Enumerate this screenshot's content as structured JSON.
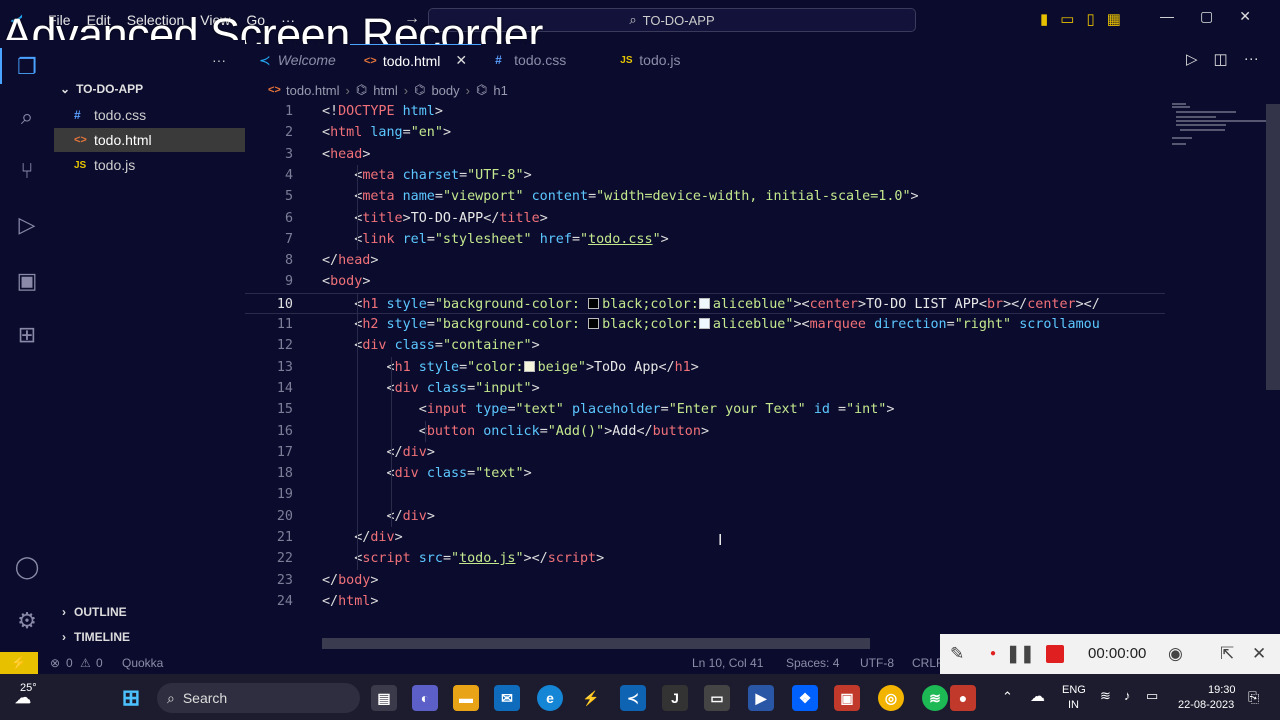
{
  "overlay_title": "Advanced Screen Recorder",
  "menu": [
    "File",
    "Edit",
    "Selection",
    "View",
    "Go",
    "···"
  ],
  "command_center": "TO-DO-APP",
  "sidebar": {
    "more": "···",
    "folder": "TO-DO-APP",
    "files": [
      {
        "name": "todo.css",
        "type": "css"
      },
      {
        "name": "todo.html",
        "type": "html",
        "selected": true
      },
      {
        "name": "todo.js",
        "type": "js"
      }
    ],
    "outline": "OUTLINE",
    "timeline": "TIMELINE"
  },
  "tabs": [
    {
      "label": "Welcome",
      "icon": "vscode"
    },
    {
      "label": "todo.html",
      "icon": "html",
      "active": true
    },
    {
      "label": "todo.css",
      "icon": "css"
    },
    {
      "label": "todo.js",
      "icon": "js"
    }
  ],
  "breadcrumb": [
    "todo.html",
    "html",
    "body",
    "h1"
  ],
  "code_lines": [
    {
      "n": "1",
      "html": "<span class='p'>&lt;!</span><span class='t'>DOCTYPE</span> <span class='a'>html</span><span class='p'>&gt;</span>"
    },
    {
      "n": "2",
      "html": "<span class='p'>&lt;</span><span class='t'>html</span> <span class='a'>lang</span><span class='p'>=</span><span class='s'>\"en\"</span><span class='p'>&gt;</span>"
    },
    {
      "n": "3",
      "html": "<span class='p'>&lt;</span><span class='t'>head</span><span class='p'>&gt;</span>"
    },
    {
      "n": "4",
      "html": "    <span class='p'>&lt;</span><span class='t'>meta</span> <span class='a'>charset</span><span class='p'>=</span><span class='s'>\"UTF-8\"</span><span class='p'>&gt;</span>"
    },
    {
      "n": "5",
      "html": "    <span class='p'>&lt;</span><span class='t'>meta</span> <span class='a'>name</span><span class='p'>=</span><span class='s'>\"viewport\"</span> <span class='a'>content</span><span class='p'>=</span><span class='s'>\"width=device-width, initial-scale=1.0\"</span><span class='p'>&gt;</span>"
    },
    {
      "n": "6",
      "html": "    <span class='p'>&lt;</span><span class='t'>title</span><span class='p'>&gt;</span><span class='c'>TO-DO-APP</span><span class='p'>&lt;/</span><span class='t'>title</span><span class='p'>&gt;</span>"
    },
    {
      "n": "7",
      "html": "    <span class='p'>&lt;</span><span class='t'>link</span> <span class='a'>rel</span><span class='p'>=</span><span class='s'>\"stylesheet\"</span> <span class='a'>href</span><span class='p'>=</span><span class='s'>\"<u>todo.css</u>\"</span><span class='p'>&gt;</span>"
    },
    {
      "n": "8",
      "html": "<span class='p'>&lt;/</span><span class='t'>head</span><span class='p'>&gt;</span>"
    },
    {
      "n": "9",
      "html": "<span class='p'>&lt;</span><span class='t'>body</span><span class='p'>&gt;</span>"
    },
    {
      "n": "10",
      "html": "    <span class='p'>&lt;</span><span class='t'>h1</span> <span class='a'>style</span><span class='p'>=</span><span class='s'>\"background-color: <span class='sw' style='background:#000'></span>black;color:<span class='sw' style='background:#f0f8ff'></span>aliceblue\"</span><span class='p'>&gt;&lt;</span><span class='t'>center</span><span class='p'>&gt;</span><span class='c'>TO-DO LIST APP</span><span class='p'>&lt;</span><span class='t'>br</span><span class='p'>&gt;&lt;/</span><span class='t'>center</span><span class='p'>&gt;&lt;/</span>",
      "current": true
    },
    {
      "n": "11",
      "html": "    <span class='p'>&lt;</span><span class='t'>h2</span> <span class='a'>style</span><span class='p'>=</span><span class='s'>\"background-color: <span class='sw' style='background:#000'></span>black;color:<span class='sw' style='background:#f0f8ff'></span>aliceblue\"</span><span class='p'>&gt;&lt;</span><span class='t'>marquee</span> <span class='a'>direction</span><span class='p'>=</span><span class='s'>\"right\"</span> <span class='a'>scrollamou</span>"
    },
    {
      "n": "12",
      "html": "    <span class='p'>&lt;</span><span class='t'>div</span> <span class='a'>class</span><span class='p'>=</span><span class='s'>\"container\"</span><span class='p'>&gt;</span>"
    },
    {
      "n": "13",
      "html": "        <span class='p'>&lt;</span><span class='t'>h1</span> <span class='a'>style</span><span class='p'>=</span><span class='s'>\"color:<span class='sw' style='background:#f5f5dc'></span>beige\"</span><span class='p'>&gt;</span><span class='c'>ToDo App</span><span class='p'>&lt;/</span><span class='t'>h1</span><span class='p'>&gt;</span>"
    },
    {
      "n": "14",
      "html": "        <span class='p'>&lt;</span><span class='t'>div</span> <span class='a'>class</span><span class='p'>=</span><span class='s'>\"input\"</span><span class='p'>&gt;</span>"
    },
    {
      "n": "15",
      "html": "            <span class='p'>&lt;</span><span class='t'>input</span> <span class='a'>type</span><span class='p'>=</span><span class='s'>\"text\"</span> <span class='a'>placeholder</span><span class='p'>=</span><span class='s'>\"Enter your Text\"</span> <span class='a'>id</span> <span class='p'>=</span><span class='s'>\"int\"</span><span class='p'>&gt;</span>"
    },
    {
      "n": "16",
      "html": "            <span class='p'>&lt;</span><span class='t'>button</span> <span class='a'>onclick</span><span class='p'>=</span><span class='s'>\"Add()\"</span><span class='p'>&gt;</span><span class='c'>Add</span><span class='p'>&lt;/</span><span class='t'>button</span><span class='p'>&gt;</span>"
    },
    {
      "n": "17",
      "html": "        <span class='p'>&lt;/</span><span class='t'>div</span><span class='p'>&gt;</span>"
    },
    {
      "n": "18",
      "html": "        <span class='p'>&lt;</span><span class='t'>div</span> <span class='a'>class</span><span class='p'>=</span><span class='s'>\"text\"</span><span class='p'>&gt;</span>"
    },
    {
      "n": "19",
      "html": ""
    },
    {
      "n": "20",
      "html": "        <span class='p'>&lt;/</span><span class='t'>div</span><span class='p'>&gt;</span>"
    },
    {
      "n": "21",
      "html": "    <span class='p'>&lt;/</span><span class='t'>div</span><span class='p'>&gt;</span>"
    },
    {
      "n": "22",
      "html": "    <span class='p'>&lt;</span><span class='t'>script</span> <span class='a'>src</span><span class='p'>=</span><span class='s'>\"<u>todo.js</u>\"</span><span class='p'>&gt;&lt;/</span><span class='t'>script</span><span class='p'>&gt;</span>"
    },
    {
      "n": "23",
      "html": "<span class='p'>&lt;/</span><span class='t'>body</span><span class='p'>&gt;</span>"
    },
    {
      "n": "24",
      "html": "<span class='p'>&lt;/</span><span class='t'>html</span><span class='p'>&gt;</span>"
    }
  ],
  "status": {
    "errors": "0",
    "warnings": "0",
    "quokka": "Quokka",
    "position": "Ln 10, Col 41",
    "spaces": "Spaces: 4",
    "encoding": "UTF-8",
    "eol": "CRLF"
  },
  "recorder": {
    "timer": "00:00:00"
  },
  "taskbar": {
    "weather": "25°",
    "search": "Search",
    "lang": "ENG",
    "region": "IN",
    "time": "19:30",
    "date": "22-08-2023"
  },
  "colors": {
    "accent": "#4aa3ff",
    "bg": "#0b0b2e",
    "tag": "#f07178",
    "attr": "#5cc8ff",
    "string": "#c3e88d",
    "remote": "#e7c000"
  }
}
